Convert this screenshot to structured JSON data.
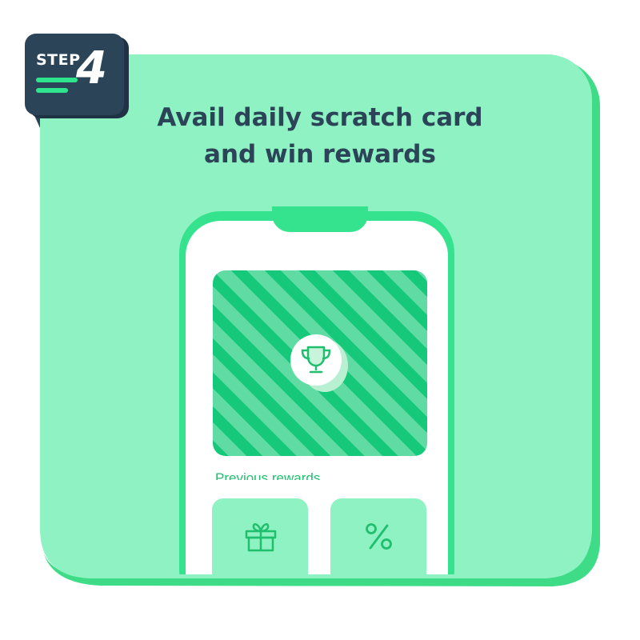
{
  "badge": {
    "step_label": "STEP",
    "step_number": "4"
  },
  "title": {
    "line1": "Avail daily scratch card",
    "line2": "and win rewards"
  },
  "scratch_card": {
    "icon": "trophy-icon"
  },
  "previous_rewards": {
    "label": "Previous rewards",
    "tiles": [
      {
        "icon": "gift-icon"
      },
      {
        "icon": "percent-icon"
      }
    ]
  },
  "colors": {
    "card_bg": "#8ff2c2",
    "accent_green": "#35e28e",
    "dark_navy": "#2b4458",
    "stripe_dark": "#16c97a",
    "stripe_light": "#5fdba3"
  }
}
